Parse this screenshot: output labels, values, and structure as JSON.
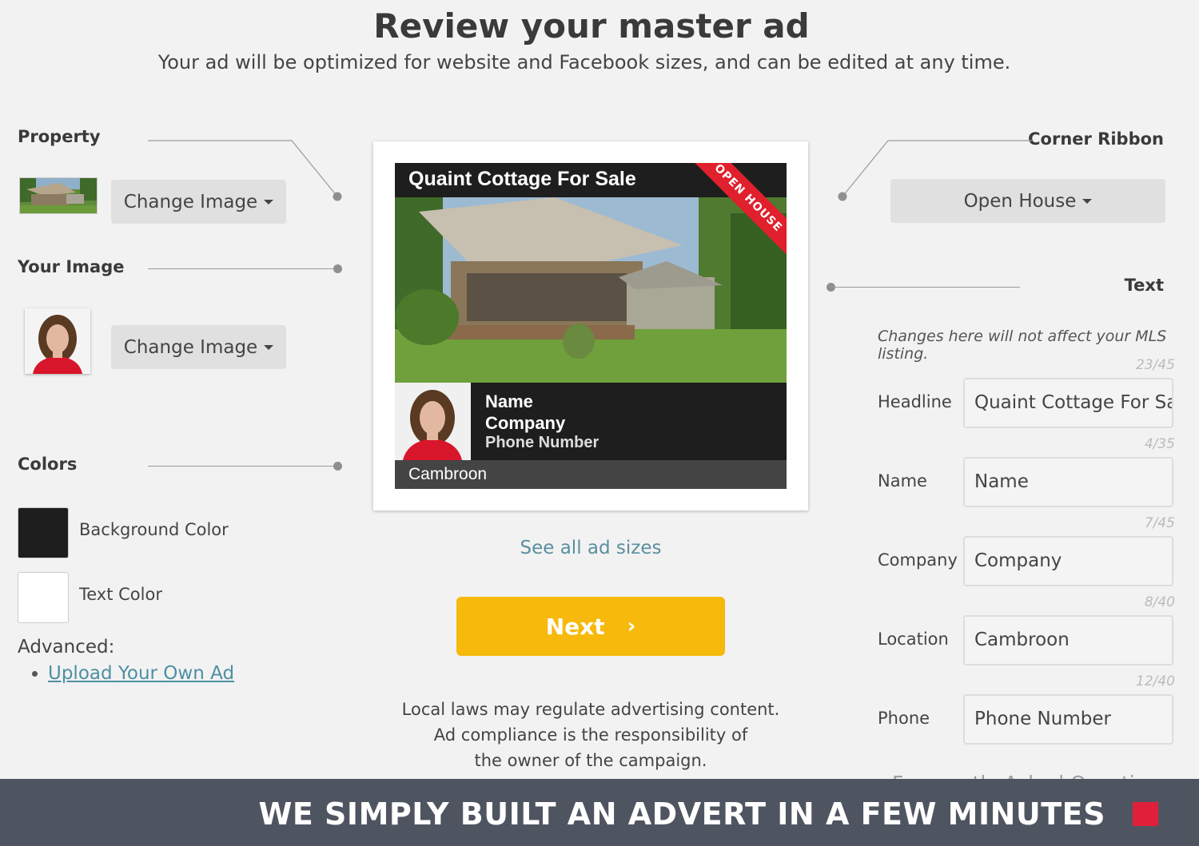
{
  "header": {
    "title": "Review your master ad",
    "subtitle": "Your ad will be optimized for website and Facebook sizes, and can be edited at any time."
  },
  "left": {
    "property_label": "Property",
    "property_button": "Change Image",
    "your_image_label": "Your Image",
    "your_image_button": "Change Image",
    "colors_label": "Colors",
    "background_color_label": "Background Color",
    "background_color": "#1e1e1e",
    "text_color_label": "Text Color",
    "text_color": "#ffffff",
    "advanced_label": "Advanced:",
    "upload_link": "Upload Your Own Ad"
  },
  "ad_preview": {
    "headline": "Quaint Cottage For Sale",
    "ribbon": "OPEN HOUSE",
    "name": "Name",
    "company": "Company",
    "phone": "Phone Number",
    "location": "Cambroon"
  },
  "center": {
    "see_all": "See all ad sizes",
    "next_label": "Next",
    "next_icon": "chevron-right-icon",
    "disclaimer_line1": "Local laws may regulate advertising content.",
    "disclaimer_line2": "Ad compliance is the responsibility of",
    "disclaimer_line3": "the owner of the campaign."
  },
  "right": {
    "corner_ribbon_label": "Corner Ribbon",
    "corner_ribbon_value": "Open House",
    "text_label": "Text",
    "mls_note": "Changes here will not affect your MLS listing.",
    "fields": [
      {
        "label": "Headline",
        "value": "Quaint Cottage For Sal",
        "counter": "23/45"
      },
      {
        "label": "Name",
        "value": "Name",
        "counter": "4/35"
      },
      {
        "label": "Company",
        "value": "Company",
        "counter": "7/45"
      },
      {
        "label": "Location",
        "value": "Cambroon",
        "counter": "8/40"
      },
      {
        "label": "Phone",
        "value": "Phone Number",
        "counter": "12/40"
      }
    ]
  },
  "footer": {
    "faq": "Frequently Asked Questions",
    "banner": "WE SIMPLY BUILT AN ADVERT IN A FEW MINUTES",
    "accent": "#e0203a"
  }
}
